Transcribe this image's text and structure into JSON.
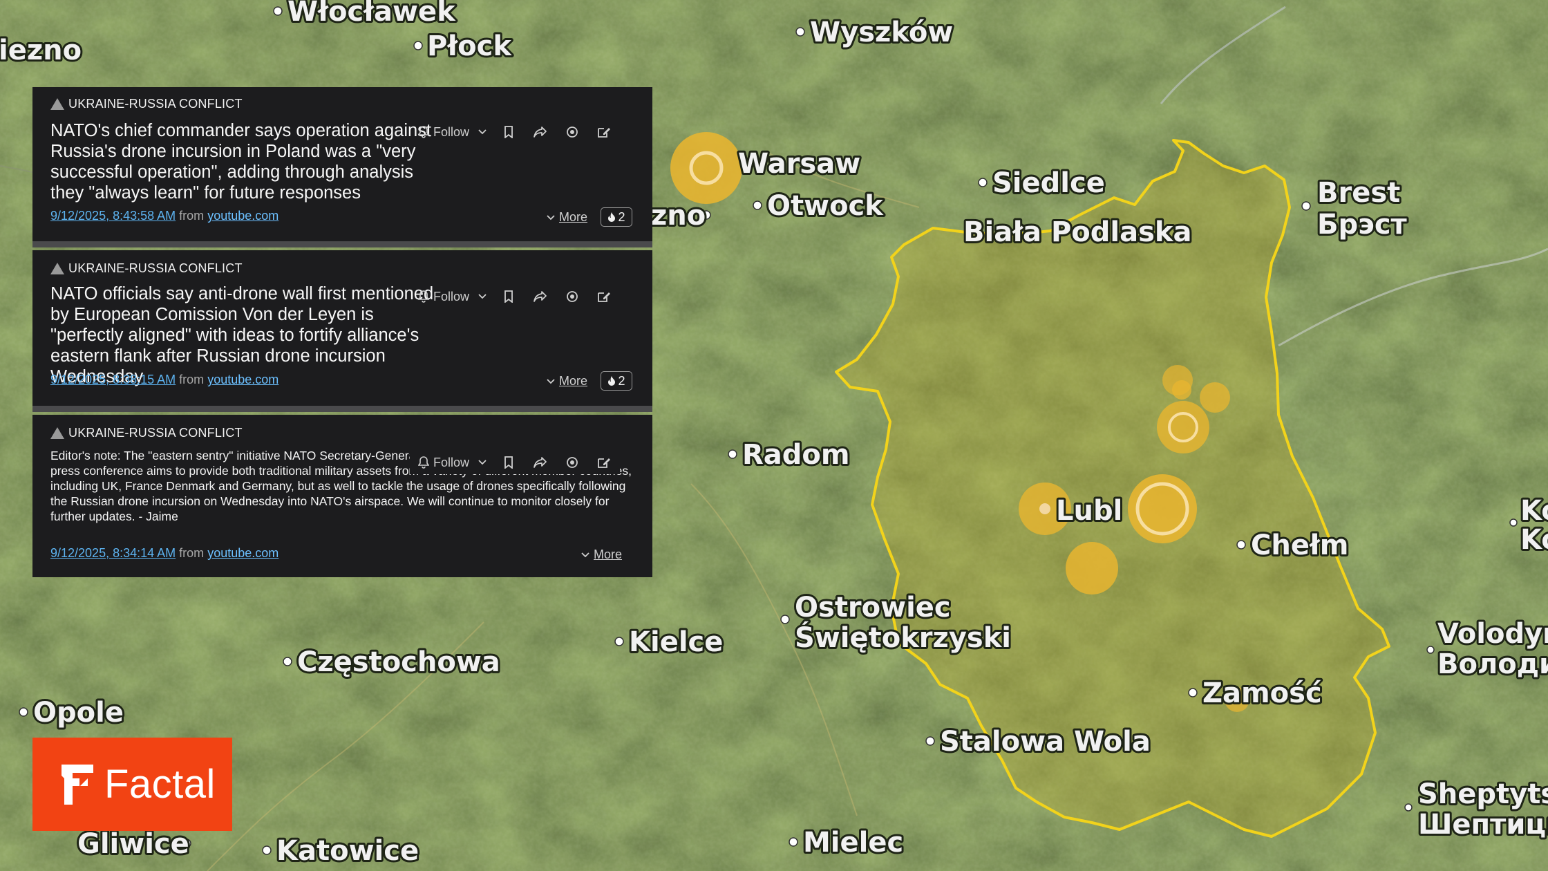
{
  "map": {
    "cities": [
      {
        "name": "Włocławek"
      },
      {
        "name": "iezno"
      },
      {
        "name": "Płock"
      },
      {
        "name": "Wyszków"
      },
      {
        "name": "Warsaw"
      },
      {
        "name": "zno"
      },
      {
        "name": "Otwock"
      },
      {
        "name": "Siedlce"
      },
      {
        "name": "Biała Podlaska"
      },
      {
        "name": "Brest"
      },
      {
        "name": "Брэст"
      },
      {
        "name": "Radom"
      },
      {
        "name": "Lubl"
      },
      {
        "name": "Chełm"
      },
      {
        "name": "Ostrowiec"
      },
      {
        "name": "Świętokrzyski"
      },
      {
        "name": "Kielce"
      },
      {
        "name": "Częstochowa"
      },
      {
        "name": "Opole"
      },
      {
        "name": "Zamość"
      },
      {
        "name": "Stalowa Wola"
      },
      {
        "name": "Gliwice"
      },
      {
        "name": "Katowice"
      },
      {
        "name": "Mielec"
      },
      {
        "name": "Volodym"
      },
      {
        "name": "Володим"
      },
      {
        "name": "Sheptytsk"
      },
      {
        "name": "Шептицьк"
      },
      {
        "name": "Ko"
      },
      {
        "name": "Ko"
      }
    ],
    "colors": {
      "region_border": "#f2d31b",
      "marker": "#e8b530",
      "marker_ring": "#f7dea0"
    }
  },
  "cards": [
    {
      "topic": "UKRAINE-RUSSIA CONFLICT",
      "headline": "NATO's chief commander says operation against Russia's drone incursion in Poland was a \"very successful operation\", adding through analysis they \"always learn\" for future responses",
      "timestamp": "9/12/2025, 8:43:58 AM",
      "from": "from",
      "source": "youtube.com",
      "follow": "Follow",
      "more": "More",
      "count": "2"
    },
    {
      "topic": "UKRAINE-RUSSIA CONFLICT",
      "headline": "NATO officials say anti-drone wall first mentioned by European Comission Von der Leyen is \"perfectly aligned\" with ideas to fortify alliance's eastern flank after Russian drone incursion Wednesday",
      "timestamp": "9/12/2025, 8:38:15 AM",
      "from": "from",
      "source": "youtube.com",
      "follow": "Follow",
      "more": "More",
      "count": "2"
    },
    {
      "topic": "UKRAINE-RUSSIA CONFLICT",
      "headline": "Editor's note: The \"eastern sentry\" initiative NATO Secretary-General Mark Rutte announced in his latest press conference aims to provide both traditional military assets from a variety of different member countries, including UK, France Denmark and Germany, but as well to tackle the usage of drones specifically following the Russian drone incursion on Wednesday into NATO's airspace. We will continue to monitor closely for further updates. - Jaime",
      "timestamp": "9/12/2025, 8:34:14 AM",
      "from": "from",
      "source": "youtube.com",
      "follow": "Follow",
      "more": "More"
    }
  ],
  "logo": {
    "text": "Factal",
    "color": "#f24313"
  }
}
